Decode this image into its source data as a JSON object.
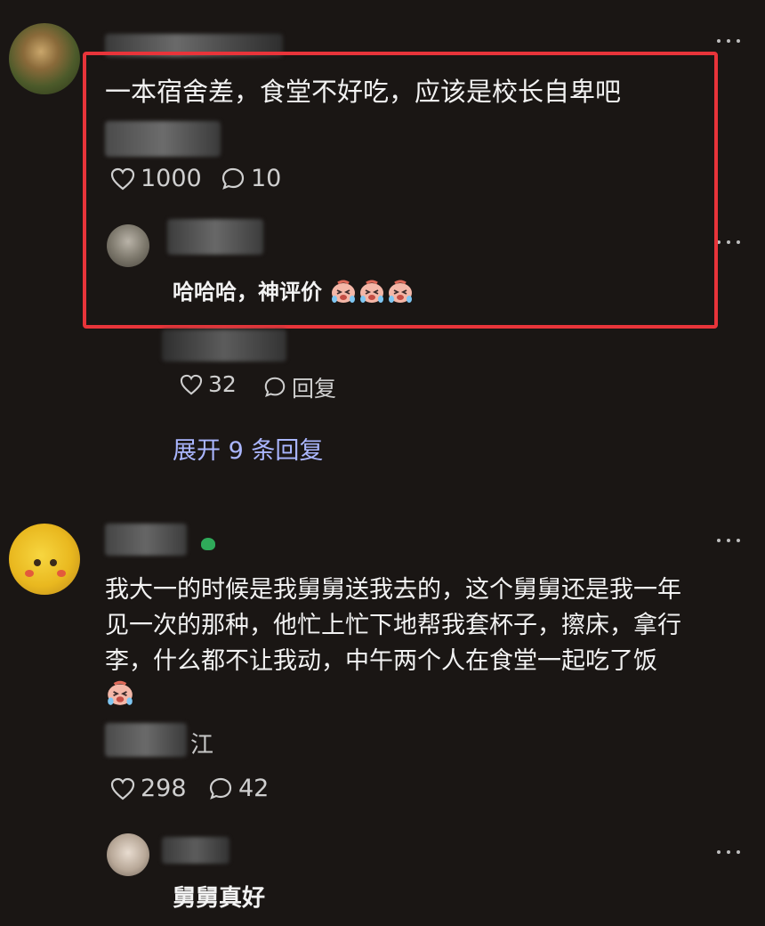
{
  "comments": [
    {
      "text": "一本宿舍差，食堂不好吃，应该是校长自卑吧",
      "likes": "1000",
      "replies_count": "10",
      "reply": {
        "text": "哈哈哈，神评价",
        "emoji_count": 3
      }
    },
    {
      "reply_likes": "32",
      "reply_label": "回复",
      "expand_label": "展开 9 条回复"
    },
    {
      "text_line1": "我大一的时候是我舅舅送我去的，这个舅舅还是我一年",
      "text_line2": "见一次的那种，他忙上忙下地帮我套杯子，擦床，拿行",
      "text_line3": "李，什么都不让我动，中午两个人在食堂一起吃了饭",
      "location_fragment": "江",
      "likes": "298",
      "replies_count": "42",
      "reply": {
        "text": "舅舅真好"
      }
    }
  ],
  "colors": {
    "background": "#1a1614",
    "highlight_border": "#e8343a",
    "link": "#aab6ff"
  },
  "icons": {
    "like": "heart-outline-icon",
    "comment": "comment-bubble-icon",
    "more": "more-dots-icon",
    "emoji": "crying-laughing-emoji"
  }
}
